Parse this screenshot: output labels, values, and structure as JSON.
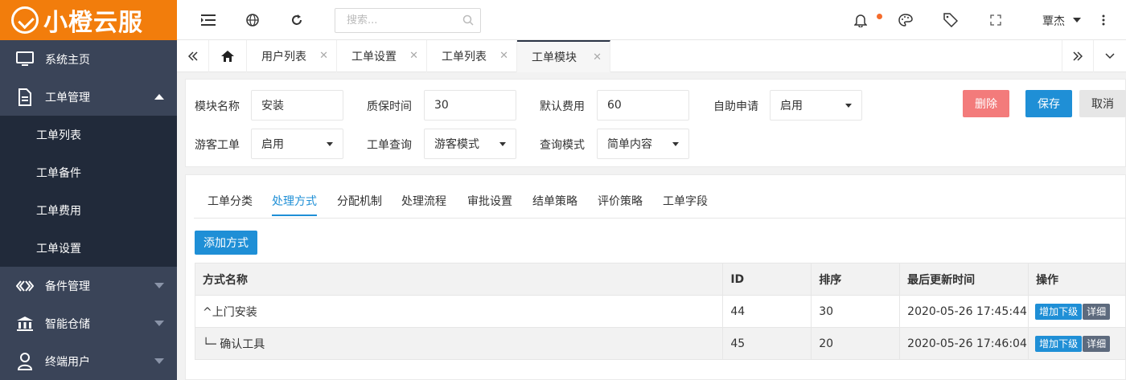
{
  "brand": {
    "name": "小橙云服",
    "color": "#f27d0c"
  },
  "sidebar": {
    "items": [
      {
        "label": "系统主页",
        "icon": "monitor-icon"
      },
      {
        "label": "工单管理",
        "icon": "document-icon",
        "expanded": true
      },
      {
        "label": "备件管理",
        "icon": "diamond-icon"
      },
      {
        "label": "智能仓储",
        "icon": "bank-icon"
      },
      {
        "label": "终端用户",
        "icon": "user-icon"
      }
    ],
    "subitems": [
      "工单列表",
      "工单备件",
      "工单费用",
      "工单设置"
    ]
  },
  "topbar": {
    "search_placeholder": "搜索...",
    "username": "覃杰",
    "icons": [
      "menu-toggle-icon",
      "globe-icon",
      "refresh-icon",
      "search-icon",
      "bell-icon",
      "palette-icon",
      "tag-icon",
      "fullscreen-icon",
      "more-vertical-icon"
    ]
  },
  "tabs": [
    {
      "label": "用户列表"
    },
    {
      "label": "工单设置"
    },
    {
      "label": "工单列表"
    },
    {
      "label": "工单模块",
      "active": true
    }
  ],
  "form": {
    "module_name": {
      "label": "模块名称",
      "value": "安装"
    },
    "warranty": {
      "label": "质保时间",
      "value": "30"
    },
    "default_fee": {
      "label": "默认费用",
      "value": "60"
    },
    "self_apply": {
      "label": "自助申请",
      "value": "启用"
    },
    "guest_ticket": {
      "label": "游客工单",
      "value": "启用"
    },
    "ticket_query": {
      "label": "工单查询",
      "value": "游客模式"
    },
    "query_mode": {
      "label": "查询模式",
      "value": "简单内容"
    },
    "delete_label": "删除",
    "save_label": "保存",
    "cancel_label": "取消"
  },
  "subtabs": [
    {
      "label": "工单分类"
    },
    {
      "label": "处理方式",
      "active": true
    },
    {
      "label": "分配机制"
    },
    {
      "label": "处理流程"
    },
    {
      "label": "审批设置"
    },
    {
      "label": "结单策略"
    },
    {
      "label": "评价策略"
    },
    {
      "label": "工单字段"
    }
  ],
  "add_button": "添加方式",
  "table": {
    "headers": [
      "方式名称",
      "ID",
      "排序",
      "最后更新时间",
      "操作"
    ],
    "rows": [
      {
        "name": "^上门安装",
        "id": "44",
        "sort": "30",
        "updated": "2020-05-26 17:45:44",
        "add_label": "增加下级",
        "detail_label": "详细"
      },
      {
        "name": "└─ 确认工具",
        "id": "45",
        "sort": "20",
        "updated": "2020-05-26 17:46:04",
        "add_label": "增加下级",
        "detail_label": "详细"
      }
    ]
  },
  "colors": {
    "sidebar_bg": "#2b3446",
    "primary": "#1f8fd6",
    "danger": "#f37b7b"
  }
}
